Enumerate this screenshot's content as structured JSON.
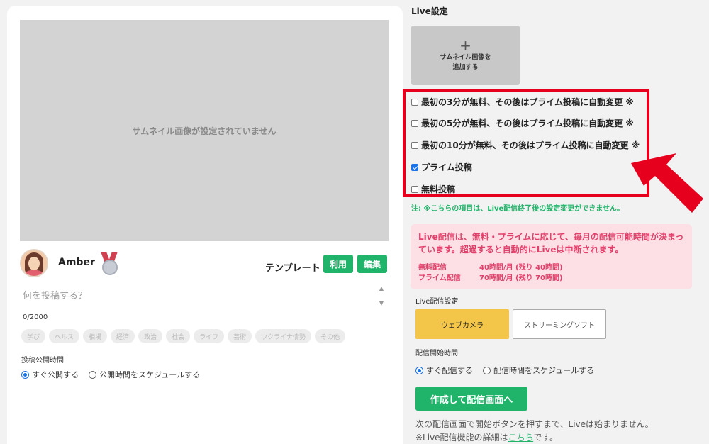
{
  "left": {
    "thumbnail_placeholder": "サムネイル画像が設定されていません",
    "author_name": "Amber",
    "template_label": "テンプレート",
    "use_button": "利用",
    "edit_button": "編集",
    "post_placeholder": "何を投稿する？",
    "char_count": "0/2000",
    "tags": [
      "学び",
      "ヘルス",
      "相場",
      "経済",
      "政治",
      "社会",
      "ライフ",
      "芸術",
      "ウクライナ情勢",
      "その他"
    ],
    "publish_label": "投稿公開時間",
    "publish_options": [
      "すぐ公開する",
      "公開時間をスケジュールする"
    ]
  },
  "right": {
    "title": "Live設定",
    "add_thumbnail": "サムネイル画像を\n追加する",
    "checkboxes": [
      {
        "label": "最初の3分が無料、その後はプライム投稿に自動変更 ※",
        "checked": false
      },
      {
        "label": "最初の5分が無料、その後はプライム投稿に自動変更 ※",
        "checked": false
      },
      {
        "label": "最初の10分が無料、その後はプライム投稿に自動変更 ※",
        "checked": false
      },
      {
        "label": "プライム投稿",
        "checked": true
      },
      {
        "label": "無料投稿",
        "checked": false
      }
    ],
    "note": "注: ※こちらの項目は、Live配信終了後の設定変更ができません。",
    "pink_message": "Live配信は、無料・プライムに応じて、毎月の配信可能時間が決まっています。超過すると自動的にLiveは中断されます。",
    "quota_free_label": "無料配信",
    "quota_free_value": "40時間/月 (残り 40時間)",
    "quota_prime_label": "プライム配信",
    "quota_prime_value": "70時間/月 (残り 70時間)",
    "stream_settings_label": "Live配信設定",
    "webcam_button": "ウェブカメラ",
    "software_button": "ストリーミングソフト",
    "start_time_label": "配信開始時間",
    "start_options": [
      "すぐ配信する",
      "配信時間をスケジュールする"
    ],
    "create_button": "作成して配信画面へ",
    "info_line1": "次の配信画面で開始ボタンを押すまで、Liveは始まりません。",
    "info_line2_prefix": "※Live配信機能の詳細は",
    "info_link": "こちら",
    "info_line2_suffix": "です。"
  },
  "colors": {
    "accent_green": "#20b46a",
    "highlight_red": "#e6001e",
    "webcam_yellow": "#f3c64a",
    "pink_bg": "#fde0e6",
    "pink_text": "#e0406a"
  }
}
